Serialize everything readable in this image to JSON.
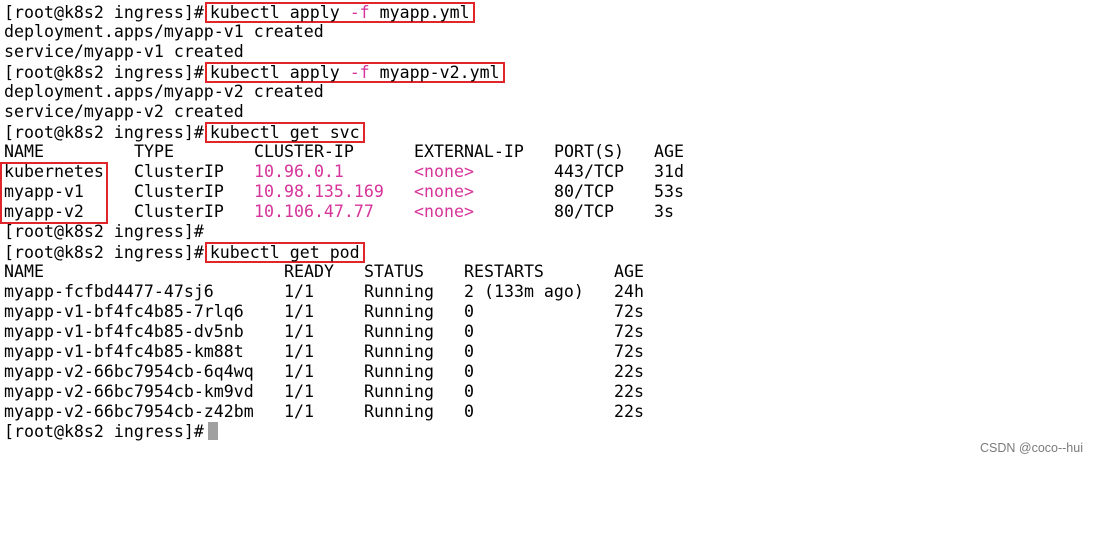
{
  "prompt": "[root@k8s2 ingress]#",
  "commands": {
    "apply_v1": {
      "base": "kubectl apply ",
      "flag": "-f",
      "file": " myapp.yml"
    },
    "apply_v2": {
      "base": "kubectl apply ",
      "flag": "-f",
      "file": " myapp-v2.yml"
    },
    "get_svc": "kubectl get svc",
    "get_pod": "kubectl get pod"
  },
  "outputs": {
    "v1_deploy": "deployment.apps/myapp-v1 created",
    "v1_service": "service/myapp-v1 created",
    "v2_deploy": "deployment.apps/myapp-v2 created",
    "v2_service": "service/myapp-v2 created"
  },
  "svc_table": {
    "headers": [
      "NAME",
      "TYPE",
      "CLUSTER-IP",
      "EXTERNAL-IP",
      "PORT(S)",
      "AGE"
    ],
    "rows": [
      [
        "kubernetes",
        "ClusterIP",
        "10.96.0.1",
        "<none>",
        "443/TCP",
        "31d"
      ],
      [
        "myapp-v1",
        "ClusterIP",
        "10.98.135.169",
        "<none>",
        "80/TCP",
        "53s"
      ],
      [
        "myapp-v2",
        "ClusterIP",
        "10.106.47.77",
        "<none>",
        "80/TCP",
        "3s"
      ]
    ]
  },
  "pod_table": {
    "headers": [
      "NAME",
      "READY",
      "STATUS",
      "RESTARTS",
      "AGE"
    ],
    "rows": [
      [
        "myapp-fcfbd4477-47sj6",
        "1/1",
        "Running",
        "2 (133m ago)",
        "24h"
      ],
      [
        "myapp-v1-bf4fc4b85-7rlq6",
        "1/1",
        "Running",
        "0",
        "72s"
      ],
      [
        "myapp-v1-bf4fc4b85-dv5nb",
        "1/1",
        "Running",
        "0",
        "72s"
      ],
      [
        "myapp-v1-bf4fc4b85-km88t",
        "1/1",
        "Running",
        "0",
        "72s"
      ],
      [
        "myapp-v2-66bc7954cb-6q4wq",
        "1/1",
        "Running",
        "0",
        "22s"
      ],
      [
        "myapp-v2-66bc7954cb-km9vd",
        "1/1",
        "Running",
        "0",
        "22s"
      ],
      [
        "myapp-v2-66bc7954cb-z42bm",
        "1/1",
        "Running",
        "0",
        "22s"
      ]
    ]
  },
  "watermark": "CSDN @coco--hui",
  "colors": {
    "highlight_box": "#e0262b",
    "magenta": "#d6349a",
    "cursor": "#a0a0a0"
  }
}
